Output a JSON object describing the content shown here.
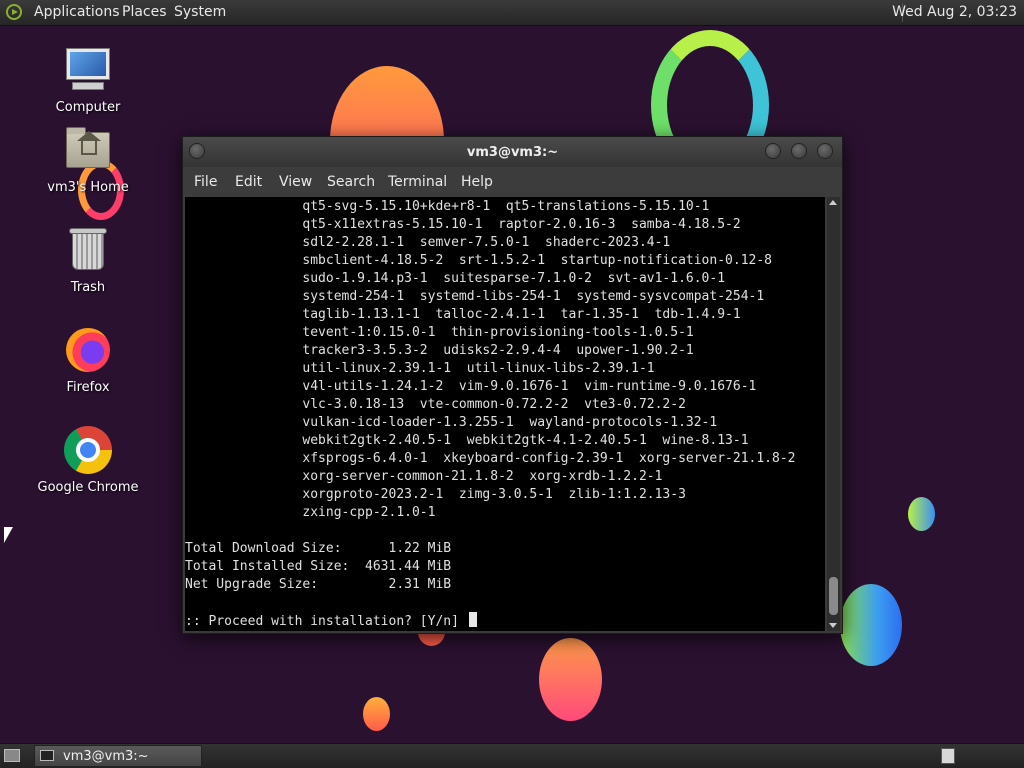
{
  "top_panel": {
    "applications": "Applications",
    "places": "Places",
    "system": "System",
    "clock": "Wed Aug  2, 03:23"
  },
  "desktop_icons": {
    "computer": "Computer",
    "home": "vm3's Home",
    "trash": "Trash",
    "firefox": "Firefox",
    "chrome": "Google Chrome"
  },
  "terminal": {
    "title": "vm3@vm3:~",
    "menu": {
      "file": "File",
      "edit": "Edit",
      "view": "View",
      "search": "Search",
      "terminal": "Terminal",
      "help": "Help"
    },
    "lines": [
      "               qt5-svg-5.15.10+kde+r8-1  qt5-translations-5.15.10-1",
      "               qt5-x11extras-5.15.10-1  raptor-2.0.16-3  samba-4.18.5-2",
      "               sdl2-2.28.1-1  semver-7.5.0-1  shaderc-2023.4-1",
      "               smbclient-4.18.5-2  srt-1.5.2-1  startup-notification-0.12-8",
      "               sudo-1.9.14.p3-1  suitesparse-7.1.0-2  svt-av1-1.6.0-1",
      "               systemd-254-1  systemd-libs-254-1  systemd-sysvcompat-254-1",
      "               taglib-1.13.1-1  talloc-2.4.1-1  tar-1.35-1  tdb-1.4.9-1",
      "               tevent-1:0.15.0-1  thin-provisioning-tools-1.0.5-1",
      "               tracker3-3.5.3-2  udisks2-2.9.4-4  upower-1.90.2-1",
      "               util-linux-2.39.1-1  util-linux-libs-2.39.1-1",
      "               v4l-utils-1.24.1-2  vim-9.0.1676-1  vim-runtime-9.0.1676-1",
      "               vlc-3.0.18-13  vte-common-0.72.2-2  vte3-0.72.2-2",
      "               vulkan-icd-loader-1.3.255-1  wayland-protocols-1.32-1",
      "               webkit2gtk-2.40.5-1  webkit2gtk-4.1-2.40.5-1  wine-8.13-1",
      "               xfsprogs-6.4.0-1  xkeyboard-config-2.39-1  xorg-server-21.1.8-2",
      "               xorg-server-common-21.1.8-2  xorg-xrdb-1.2.2-1",
      "               xorgproto-2023.2-1  zimg-3.0.5-1  zlib-1:1.2.13-3",
      "               zxing-cpp-2.1.0-1",
      "",
      "Total Download Size:      1.22 MiB",
      "Total Installed Size:  4631.44 MiB",
      "Net Upgrade Size:         2.31 MiB",
      "",
      ":: Proceed with installation? [Y/n] "
    ]
  },
  "taskbar": {
    "terminal_task": "vm3@vm3:~"
  }
}
